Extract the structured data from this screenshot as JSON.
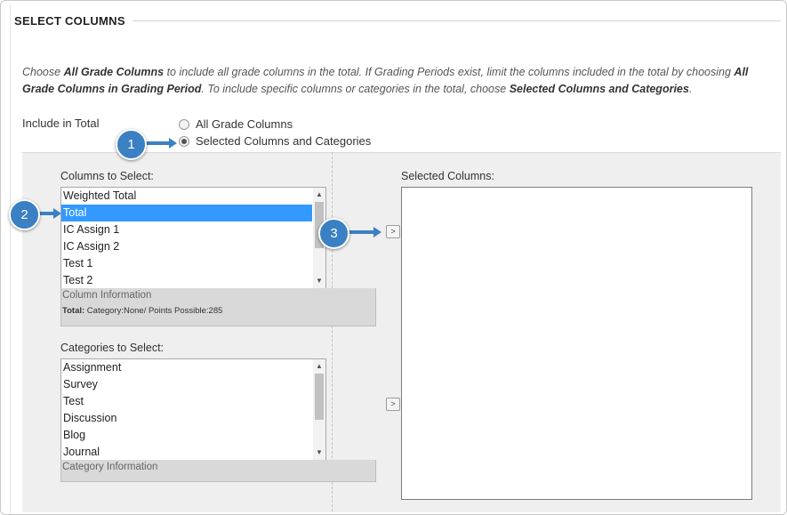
{
  "section": {
    "title": "SELECT COLUMNS"
  },
  "instructions": {
    "p1": "Choose ",
    "b1": "All Grade Columns",
    "p2": " to include all grade columns in the total. If Grading Periods exist, limit the columns included in the total by choosing ",
    "b2": "All Grade Columns in Grading Period",
    "p3": ". To include specific columns or categories in the total, choose ",
    "b3": "Selected Columns and Categories",
    "p4": "."
  },
  "include": {
    "label": "Include in Total",
    "options": [
      {
        "label": "All Grade Columns",
        "checked": false
      },
      {
        "label": "Selected Columns and Categories",
        "checked": true
      }
    ]
  },
  "columns": {
    "label": "Columns to Select:",
    "items": [
      "Weighted Total",
      "Total",
      "IC Assign 1",
      "IC Assign 2",
      "Test 1",
      "Test 2"
    ],
    "selected": "Total",
    "info_heading": "Column Information",
    "info_key": "Total:",
    "info_value": " Category:None/ Points Possible:285"
  },
  "categories": {
    "label": "Categories to Select:",
    "items": [
      "Assignment",
      "Survey",
      "Test",
      "Discussion",
      "Blog",
      "Journal"
    ],
    "info_heading": "Category Information"
  },
  "selected_columns": {
    "label": "Selected Columns:"
  },
  "callouts": [
    "1",
    "2",
    "3"
  ],
  "colors": {
    "accent": "#3a80c3",
    "selection": "#3399ff"
  }
}
